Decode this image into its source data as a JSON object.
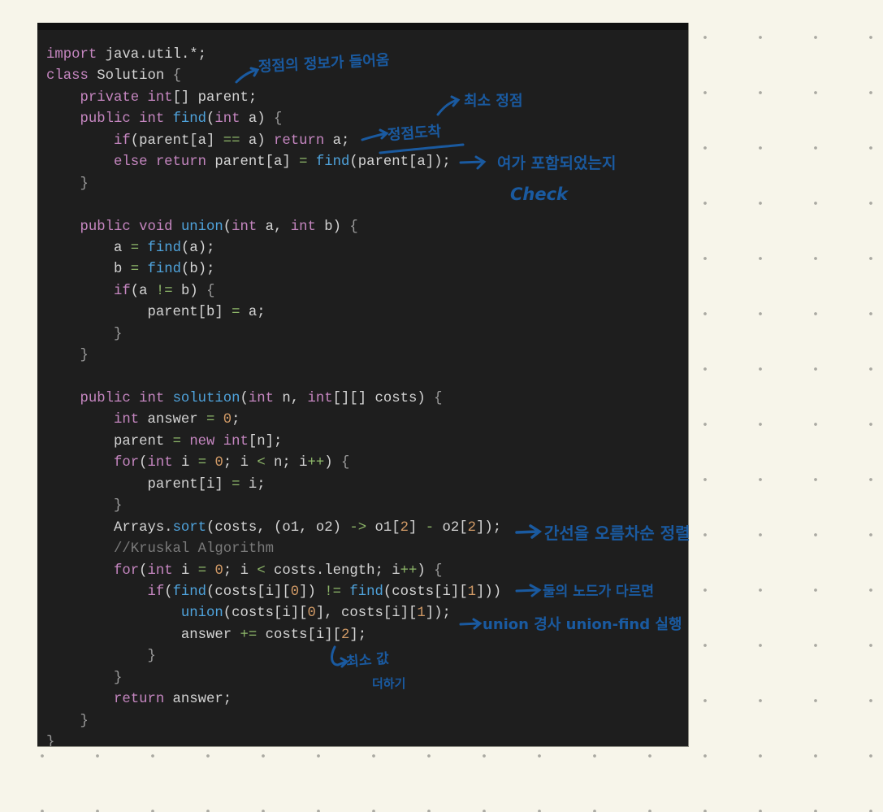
{
  "code": {
    "language": "java",
    "lines": [
      [
        {
          "t": "import",
          "c": "kw"
        },
        {
          "t": " java.util.*;",
          "c": "pl"
        }
      ],
      [
        {
          "t": "class",
          "c": "kw"
        },
        {
          "t": " Solution ",
          "c": "pl"
        },
        {
          "t": "{",
          "c": "br"
        }
      ],
      [
        {
          "t": "    private int",
          "c": "kw"
        },
        {
          "t": "[] parent;",
          "c": "pl"
        }
      ],
      [
        {
          "t": "    public int ",
          "c": "kw"
        },
        {
          "t": "find",
          "c": "fn"
        },
        {
          "t": "(",
          "c": "pl"
        },
        {
          "t": "int",
          "c": "kw"
        },
        {
          "t": " a) ",
          "c": "pl"
        },
        {
          "t": "{",
          "c": "br"
        }
      ],
      [
        {
          "t": "        if",
          "c": "kw"
        },
        {
          "t": "(parent[a] ",
          "c": "pl"
        },
        {
          "t": "==",
          "c": "op"
        },
        {
          "t": " a) ",
          "c": "pl"
        },
        {
          "t": "return",
          "c": "kw"
        },
        {
          "t": " a;",
          "c": "pl"
        }
      ],
      [
        {
          "t": "        else return",
          "c": "kw"
        },
        {
          "t": " parent[a] ",
          "c": "pl"
        },
        {
          "t": "=",
          "c": "op"
        },
        {
          "t": " ",
          "c": "pl"
        },
        {
          "t": "find",
          "c": "fn"
        },
        {
          "t": "(parent[a]);",
          "c": "pl"
        }
      ],
      [
        {
          "t": "    }",
          "c": "br"
        }
      ],
      [],
      [
        {
          "t": "    public void ",
          "c": "kw"
        },
        {
          "t": "union",
          "c": "fn"
        },
        {
          "t": "(",
          "c": "pl"
        },
        {
          "t": "int",
          "c": "kw"
        },
        {
          "t": " a, ",
          "c": "pl"
        },
        {
          "t": "int",
          "c": "kw"
        },
        {
          "t": " b) ",
          "c": "pl"
        },
        {
          "t": "{",
          "c": "br"
        }
      ],
      [
        {
          "t": "        a ",
          "c": "pl"
        },
        {
          "t": "=",
          "c": "op"
        },
        {
          "t": " ",
          "c": "pl"
        },
        {
          "t": "find",
          "c": "fn"
        },
        {
          "t": "(a);",
          "c": "pl"
        }
      ],
      [
        {
          "t": "        b ",
          "c": "pl"
        },
        {
          "t": "=",
          "c": "op"
        },
        {
          "t": " ",
          "c": "pl"
        },
        {
          "t": "find",
          "c": "fn"
        },
        {
          "t": "(b);",
          "c": "pl"
        }
      ],
      [
        {
          "t": "        if",
          "c": "kw"
        },
        {
          "t": "(a ",
          "c": "pl"
        },
        {
          "t": "!=",
          "c": "op"
        },
        {
          "t": " b) ",
          "c": "pl"
        },
        {
          "t": "{",
          "c": "br"
        }
      ],
      [
        {
          "t": "            parent[b] ",
          "c": "pl"
        },
        {
          "t": "=",
          "c": "op"
        },
        {
          "t": " a;",
          "c": "pl"
        }
      ],
      [
        {
          "t": "        }",
          "c": "br"
        }
      ],
      [
        {
          "t": "    }",
          "c": "br"
        }
      ],
      [],
      [
        {
          "t": "    public int ",
          "c": "kw"
        },
        {
          "t": "solution",
          "c": "fn"
        },
        {
          "t": "(",
          "c": "pl"
        },
        {
          "t": "int",
          "c": "kw"
        },
        {
          "t": " n, ",
          "c": "pl"
        },
        {
          "t": "int",
          "c": "kw"
        },
        {
          "t": "[][] costs) ",
          "c": "pl"
        },
        {
          "t": "{",
          "c": "br"
        }
      ],
      [
        {
          "t": "        int",
          "c": "kw"
        },
        {
          "t": " answer ",
          "c": "pl"
        },
        {
          "t": "=",
          "c": "op"
        },
        {
          "t": " ",
          "c": "pl"
        },
        {
          "t": "0",
          "c": "num"
        },
        {
          "t": ";",
          "c": "pl"
        }
      ],
      [
        {
          "t": "        parent ",
          "c": "pl"
        },
        {
          "t": "=",
          "c": "op"
        },
        {
          "t": " ",
          "c": "pl"
        },
        {
          "t": "new int",
          "c": "kw"
        },
        {
          "t": "[n];",
          "c": "pl"
        }
      ],
      [
        {
          "t": "        for",
          "c": "kw"
        },
        {
          "t": "(",
          "c": "pl"
        },
        {
          "t": "int",
          "c": "kw"
        },
        {
          "t": " i ",
          "c": "pl"
        },
        {
          "t": "=",
          "c": "op"
        },
        {
          "t": " ",
          "c": "pl"
        },
        {
          "t": "0",
          "c": "num"
        },
        {
          "t": "; i ",
          "c": "pl"
        },
        {
          "t": "<",
          "c": "op"
        },
        {
          "t": " n; i",
          "c": "pl"
        },
        {
          "t": "++",
          "c": "op"
        },
        {
          "t": ") ",
          "c": "pl"
        },
        {
          "t": "{",
          "c": "br"
        }
      ],
      [
        {
          "t": "            parent[i] ",
          "c": "pl"
        },
        {
          "t": "=",
          "c": "op"
        },
        {
          "t": " i;",
          "c": "pl"
        }
      ],
      [
        {
          "t": "        }",
          "c": "br"
        }
      ],
      [
        {
          "t": "        Arrays.",
          "c": "pl"
        },
        {
          "t": "sort",
          "c": "fn"
        },
        {
          "t": "(costs, (o1, o2) ",
          "c": "pl"
        },
        {
          "t": "->",
          "c": "op"
        },
        {
          "t": " o1[",
          "c": "pl"
        },
        {
          "t": "2",
          "c": "num"
        },
        {
          "t": "] ",
          "c": "pl"
        },
        {
          "t": "-",
          "c": "op"
        },
        {
          "t": " o2[",
          "c": "pl"
        },
        {
          "t": "2",
          "c": "num"
        },
        {
          "t": "]);",
          "c": "pl"
        }
      ],
      [
        {
          "t": "        //Kruskal Algorithm",
          "c": "cm"
        }
      ],
      [
        {
          "t": "        for",
          "c": "kw"
        },
        {
          "t": "(",
          "c": "pl"
        },
        {
          "t": "int",
          "c": "kw"
        },
        {
          "t": " i ",
          "c": "pl"
        },
        {
          "t": "=",
          "c": "op"
        },
        {
          "t": " ",
          "c": "pl"
        },
        {
          "t": "0",
          "c": "num"
        },
        {
          "t": "; i ",
          "c": "pl"
        },
        {
          "t": "<",
          "c": "op"
        },
        {
          "t": " costs.length; i",
          "c": "pl"
        },
        {
          "t": "++",
          "c": "op"
        },
        {
          "t": ") ",
          "c": "pl"
        },
        {
          "t": "{",
          "c": "br"
        }
      ],
      [
        {
          "t": "            if",
          "c": "kw"
        },
        {
          "t": "(",
          "c": "pl"
        },
        {
          "t": "find",
          "c": "fn"
        },
        {
          "t": "(costs[i][",
          "c": "pl"
        },
        {
          "t": "0",
          "c": "num"
        },
        {
          "t": "]) ",
          "c": "pl"
        },
        {
          "t": "!=",
          "c": "op"
        },
        {
          "t": " ",
          "c": "pl"
        },
        {
          "t": "find",
          "c": "fn"
        },
        {
          "t": "(costs[i][",
          "c": "pl"
        },
        {
          "t": "1",
          "c": "num"
        },
        {
          "t": "]))",
          "c": "pl"
        }
      ],
      [
        {
          "t": "                union",
          "c": "fn"
        },
        {
          "t": "(costs[i][",
          "c": "pl"
        },
        {
          "t": "0",
          "c": "num"
        },
        {
          "t": "], costs[i][",
          "c": "pl"
        },
        {
          "t": "1",
          "c": "num"
        },
        {
          "t": "]);",
          "c": "pl"
        }
      ],
      [
        {
          "t": "                answer ",
          "c": "pl"
        },
        {
          "t": "+=",
          "c": "op"
        },
        {
          "t": " costs[i][",
          "c": "pl"
        },
        {
          "t": "2",
          "c": "num"
        },
        {
          "t": "];",
          "c": "pl"
        }
      ],
      [
        {
          "t": "            }",
          "c": "br"
        }
      ],
      [
        {
          "t": "        }",
          "c": "br"
        }
      ],
      [
        {
          "t": "        return",
          "c": "kw"
        },
        {
          "t": " answer;",
          "c": "pl"
        }
      ],
      [
        {
          "t": "    }",
          "c": "br"
        }
      ],
      [
        {
          "t": "}",
          "c": "br"
        }
      ]
    ]
  },
  "annotations": {
    "vertex_info": "정점의 정보가 들어옴",
    "min_vertex": "최소 정점",
    "vertex_arrival": "정점도착",
    "check_line1": "여가 포함되었는지",
    "check_line2": "Check",
    "sort_note": "간선을 오름차순 정렬",
    "roots_differ": "둘의 노드가 다르면",
    "union_exec": "union 경사 union-find 실행",
    "add_min": "최소 값",
    "add_min2": "더하기"
  },
  "colors": {
    "ink": "#1a5aa0",
    "editor_bg": "#1e1e1e",
    "page_bg": "#f7f5ea",
    "keyword": "#c586c0",
    "function": "#4fa3dc",
    "operator": "#8fb86a",
    "number": "#d19a66",
    "comment": "#7a7a7a"
  }
}
